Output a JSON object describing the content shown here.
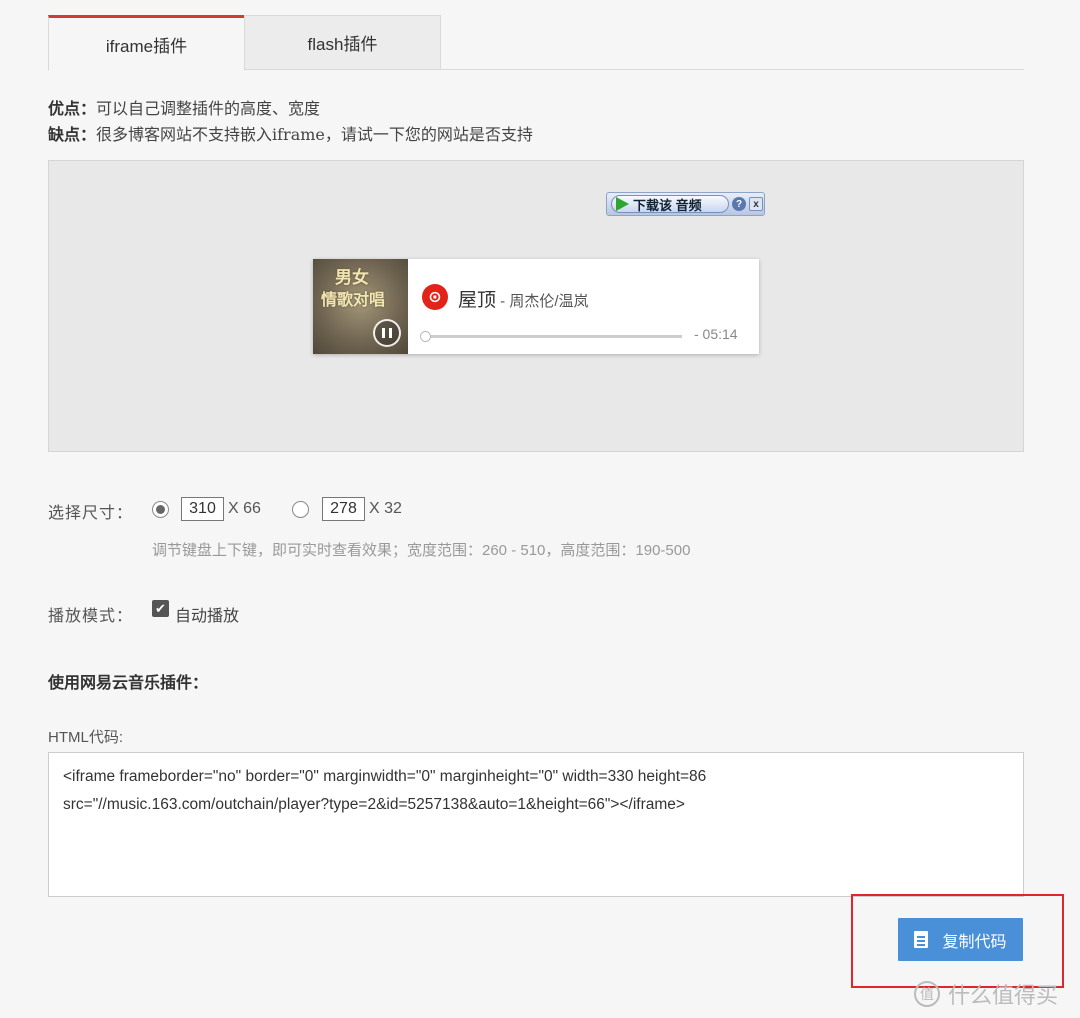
{
  "tabs": [
    {
      "label": "iframe插件",
      "active": true
    },
    {
      "label": "flash插件",
      "active": false
    }
  ],
  "proscons": {
    "pros_label": "优点：",
    "pros_text": "可以自己调整插件的高度、宽度",
    "cons_label": "缺点：",
    "cons_text": "很多博客网站不支持嵌入iframe，请试一下您的网站是否支持"
  },
  "download_bar": {
    "label": "下载该 音频",
    "help": "?",
    "close": "x"
  },
  "player": {
    "cover_text_1": "男女",
    "cover_text_2": "情歌对唱",
    "song_title": "屋顶",
    "separator": " - ",
    "artist": "周杰伦/温岚",
    "time": "- 05:14",
    "progress": 0.0
  },
  "size": {
    "label": "选择尺寸：",
    "option1_width": "310",
    "option1_x": "X 66",
    "option2_width": "278",
    "option2_x": "X 32",
    "hint": "调节键盘上下键，即可实时查看效果；宽度范围：260 - 510，高度范围：190-500"
  },
  "mode": {
    "label": "播放模式：",
    "autoplay_label": "自动播放",
    "autoplay_checked": true
  },
  "use_label": "使用网易云音乐插件：",
  "html_label": "HTML代码:",
  "code": "<iframe frameborder=\"no\" border=\"0\" marginwidth=\"0\" marginheight=\"0\" width=330 height=86\nsrc=\"//music.163.com/outchain/player?type=2&id=5257138&auto=1&height=66\"></iframe>",
  "copy_button": "复制代码",
  "watermark": "什么值得买",
  "colors": {
    "accent": "#d33a31",
    "button": "#4a90d9",
    "highlight": "#e0262c"
  }
}
